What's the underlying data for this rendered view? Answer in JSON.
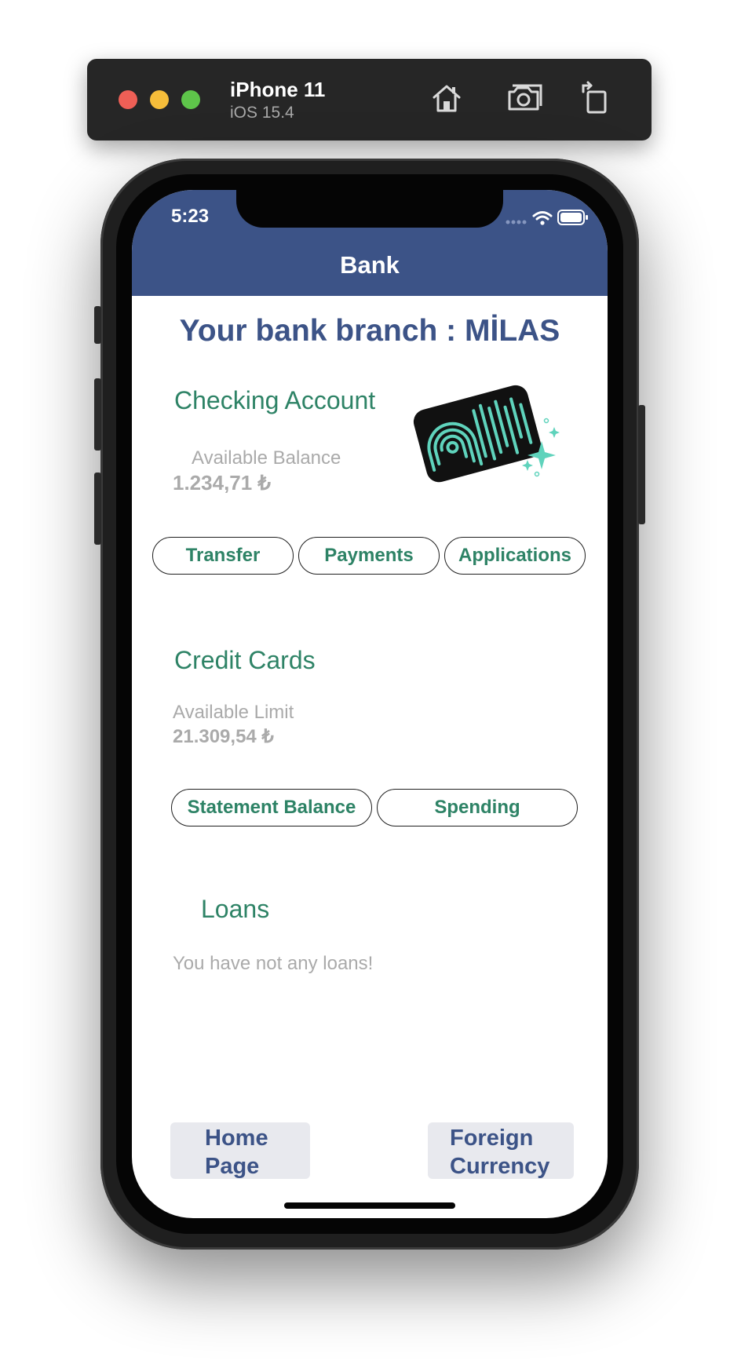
{
  "simulator": {
    "device_name": "iPhone 11",
    "os_version": "iOS 15.4",
    "icons": [
      "home-icon",
      "screenshot-camera-icon",
      "rotate-icon"
    ]
  },
  "status_bar": {
    "time": "5:23",
    "icons": [
      "signal-icon",
      "wifi-icon",
      "battery-icon"
    ]
  },
  "nav": {
    "title": "Bank"
  },
  "branch_title": "Your bank branch : MİLAS",
  "checking": {
    "title": "Checking Account",
    "balance_label": "Available Balance",
    "balance_value": "1.234,71 ₺",
    "image": "fingerprint-card-illustration",
    "buttons": [
      "Transfer",
      "Payments",
      "Applications"
    ]
  },
  "credit_cards": {
    "title": "Credit Cards",
    "limit_label": "Available Limit",
    "limit_value": "21.309,54 ₺",
    "buttons": [
      "Statement Balance",
      "Spending"
    ]
  },
  "loans": {
    "title": "Loans",
    "message": "You have not any loans!"
  },
  "bottom": {
    "home_line1": "Home",
    "home_line2": "Page",
    "foreign_line1": "Foreign",
    "foreign_line2": "Currency"
  },
  "colors": {
    "brand_blue": "#3c5387",
    "accent_green": "#2e8366",
    "muted_grey": "#aaaaaa",
    "illustration_teal": "#5fd3bc"
  }
}
